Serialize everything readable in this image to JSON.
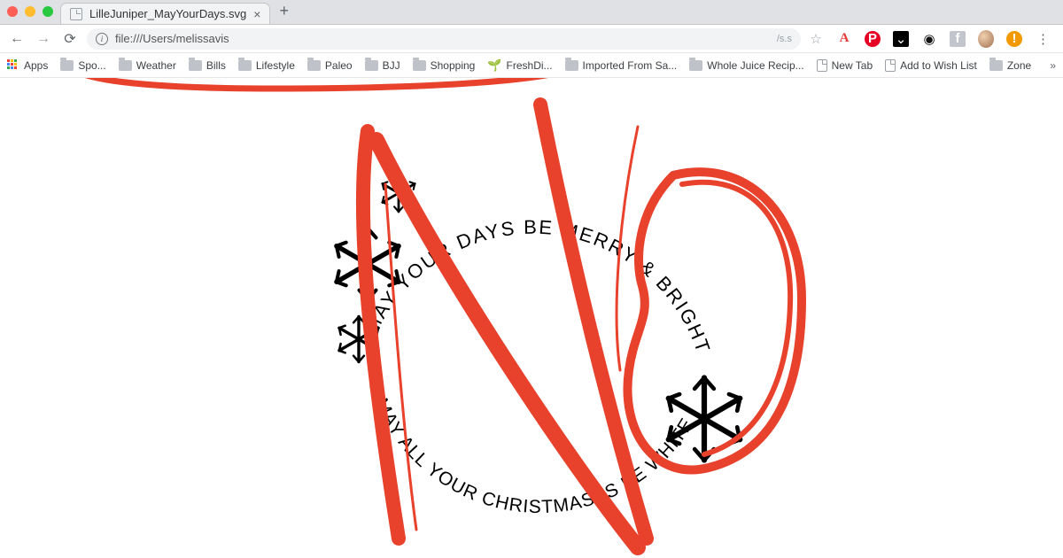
{
  "window": {
    "tab_title": "LilleJuniper_MayYourDays.svg",
    "new_tab_symbol": "+"
  },
  "address_bar": {
    "url": "file:///Users/melissavis",
    "url_fade": "/s.s",
    "info_symbol": "i"
  },
  "toolbar_icons": {
    "star": "☆",
    "letterA": "A",
    "pinterest": "P",
    "pocket": "⌄",
    "camera": "◉",
    "fb": "f",
    "warn": "!",
    "kebab": "⋮"
  },
  "bookmarks": {
    "apps_label": "Apps",
    "items": [
      {
        "label": "Spo...",
        "type": "folder"
      },
      {
        "label": "Weather",
        "type": "folder"
      },
      {
        "label": "Bills",
        "type": "folder"
      },
      {
        "label": "Lifestyle",
        "type": "folder"
      },
      {
        "label": "Paleo",
        "type": "folder"
      },
      {
        "label": "BJJ",
        "type": "folder"
      },
      {
        "label": "Shopping",
        "type": "folder"
      },
      {
        "label": "FreshDi...",
        "type": "leaf"
      },
      {
        "label": "Imported From Sa...",
        "type": "folder"
      },
      {
        "label": "Whole Juice Recip...",
        "type": "folder"
      },
      {
        "label": "New Tab",
        "type": "page"
      },
      {
        "label": "Add to Wish List",
        "type": "page"
      },
      {
        "label": "Zone",
        "type": "folder"
      }
    ],
    "overflow": "»"
  },
  "svg_art": {
    "top_text": "MAY YOUR DAYS BE MERRY & BRIGHT",
    "bottom_text": "& MAY ALL YOUR CHRISTMASES BE WHITE"
  },
  "annotation_color": "#e8412c"
}
